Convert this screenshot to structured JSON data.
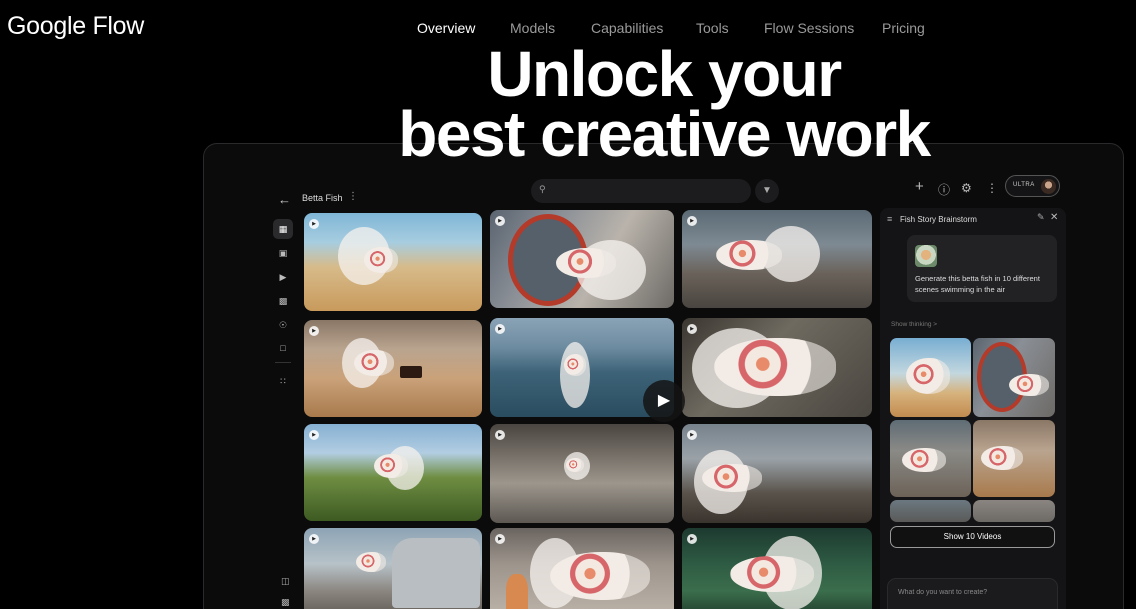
{
  "brand": {
    "logo_text": "Google Flow"
  },
  "nav": {
    "items": [
      "Overview",
      "Models",
      "Capabilities",
      "Tools",
      "Flow Sessions",
      "Pricing"
    ],
    "active": "Overview"
  },
  "hero": {
    "line1": "Unlock your",
    "line2": "best creative work"
  },
  "app": {
    "project": {
      "title": "Betta Fish",
      "back_icon": "arrow-left-icon",
      "more_icon": "kebab-icon"
    },
    "header": {
      "search_icon": "search-icon",
      "filter_icon": "filter-icon",
      "icons": [
        "plus-icon",
        "help-icon",
        "settings-icon",
        "more-vert-icon"
      ],
      "plan_badge": "ULTRA"
    },
    "rail": {
      "icons": [
        "grid-icon",
        "image-icon",
        "video-icon",
        "clapperboard-icon",
        "person-icon",
        "folder-icon",
        "apps-icon"
      ],
      "bottom_icons": [
        "trash-icon",
        "export-icon"
      ]
    },
    "panel": {
      "title": "Fish Story Brainstorm",
      "prompt": "Generate this betta fish in 10 different scenes swimming in the air",
      "show_thinking": "Show thinking >",
      "show_videos_label": "Show 10 Videos",
      "compose_placeholder": "What do you want to create?"
    }
  },
  "colors": {
    "background": "#000000",
    "app_surface": "#0b0b0c",
    "panel": "#141416",
    "nav_inactive": "#9a9a9a"
  }
}
